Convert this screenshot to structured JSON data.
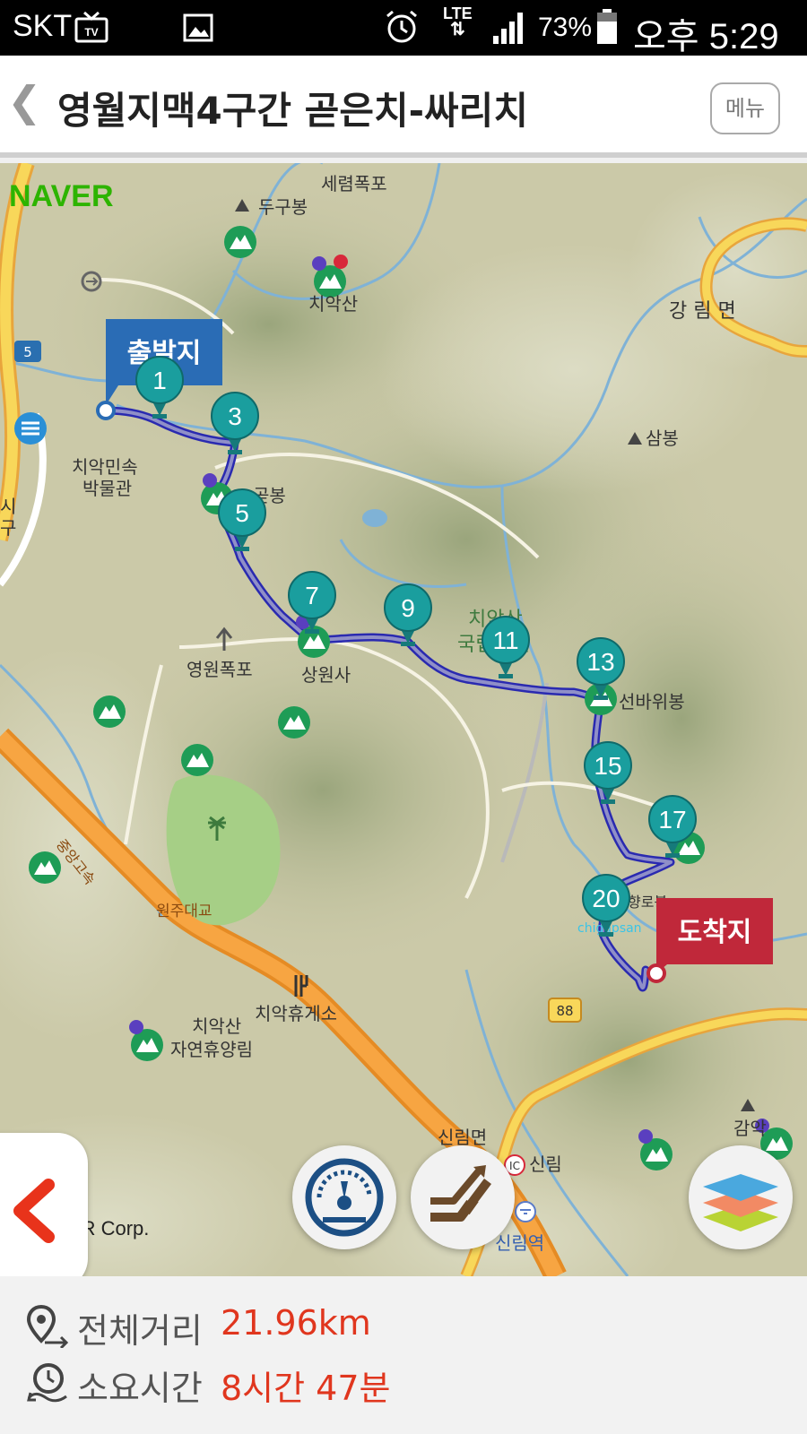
{
  "status_bar": {
    "carrier": "SKT",
    "network": "LTE",
    "battery": "73%",
    "time": "오후 5:29",
    "icons": [
      "tv-icon",
      "image-icon",
      "alarm-icon",
      "lte-icon",
      "signal-icon",
      "battery-icon"
    ]
  },
  "header": {
    "back_icon": "back-chevron-icon",
    "title": "영월지맥4구간 곧은치-싸리치",
    "menu_label": "메뉴"
  },
  "map": {
    "provider_logo": "NAVER",
    "copyright": "© NAVER Corp.",
    "start_label": "출발지",
    "end_label": "도착지",
    "watermark": "chigapsan",
    "waypoints": [
      "1",
      "3",
      "5",
      "7",
      "9",
      "11",
      "13",
      "15",
      "17",
      "20"
    ],
    "place_labels": [
      "세렴폭포",
      "두구봉",
      "치악산",
      "강 림 면",
      "삼봉",
      "치악민속",
      "박물관",
      "곧봉",
      "치악산",
      "국립공원",
      "선바위봉",
      "영원폭포",
      "상원사",
      "중앙고속",
      "원주대교",
      "치악산",
      "자연휴양림",
      "치악휴게소",
      "신림면",
      "신림",
      "신림역",
      "감악",
      "향로봉",
      "시",
      "구"
    ],
    "road_shields": [
      "5",
      "88"
    ],
    "route_color": "#3a3ad0",
    "marker_color": "#1a9e9e",
    "start_color": "#2a6cb5",
    "end_color": "#c0283a"
  },
  "controls": {
    "side_tab_icon": "chevron-left-icon",
    "buttons": [
      "speedometer-icon",
      "elevation-icon",
      "layers-icon"
    ]
  },
  "summary": {
    "distance_label": "전체거리",
    "distance_value": "21.96km",
    "time_label": "소요시간",
    "time_value": "8시간 47분"
  }
}
